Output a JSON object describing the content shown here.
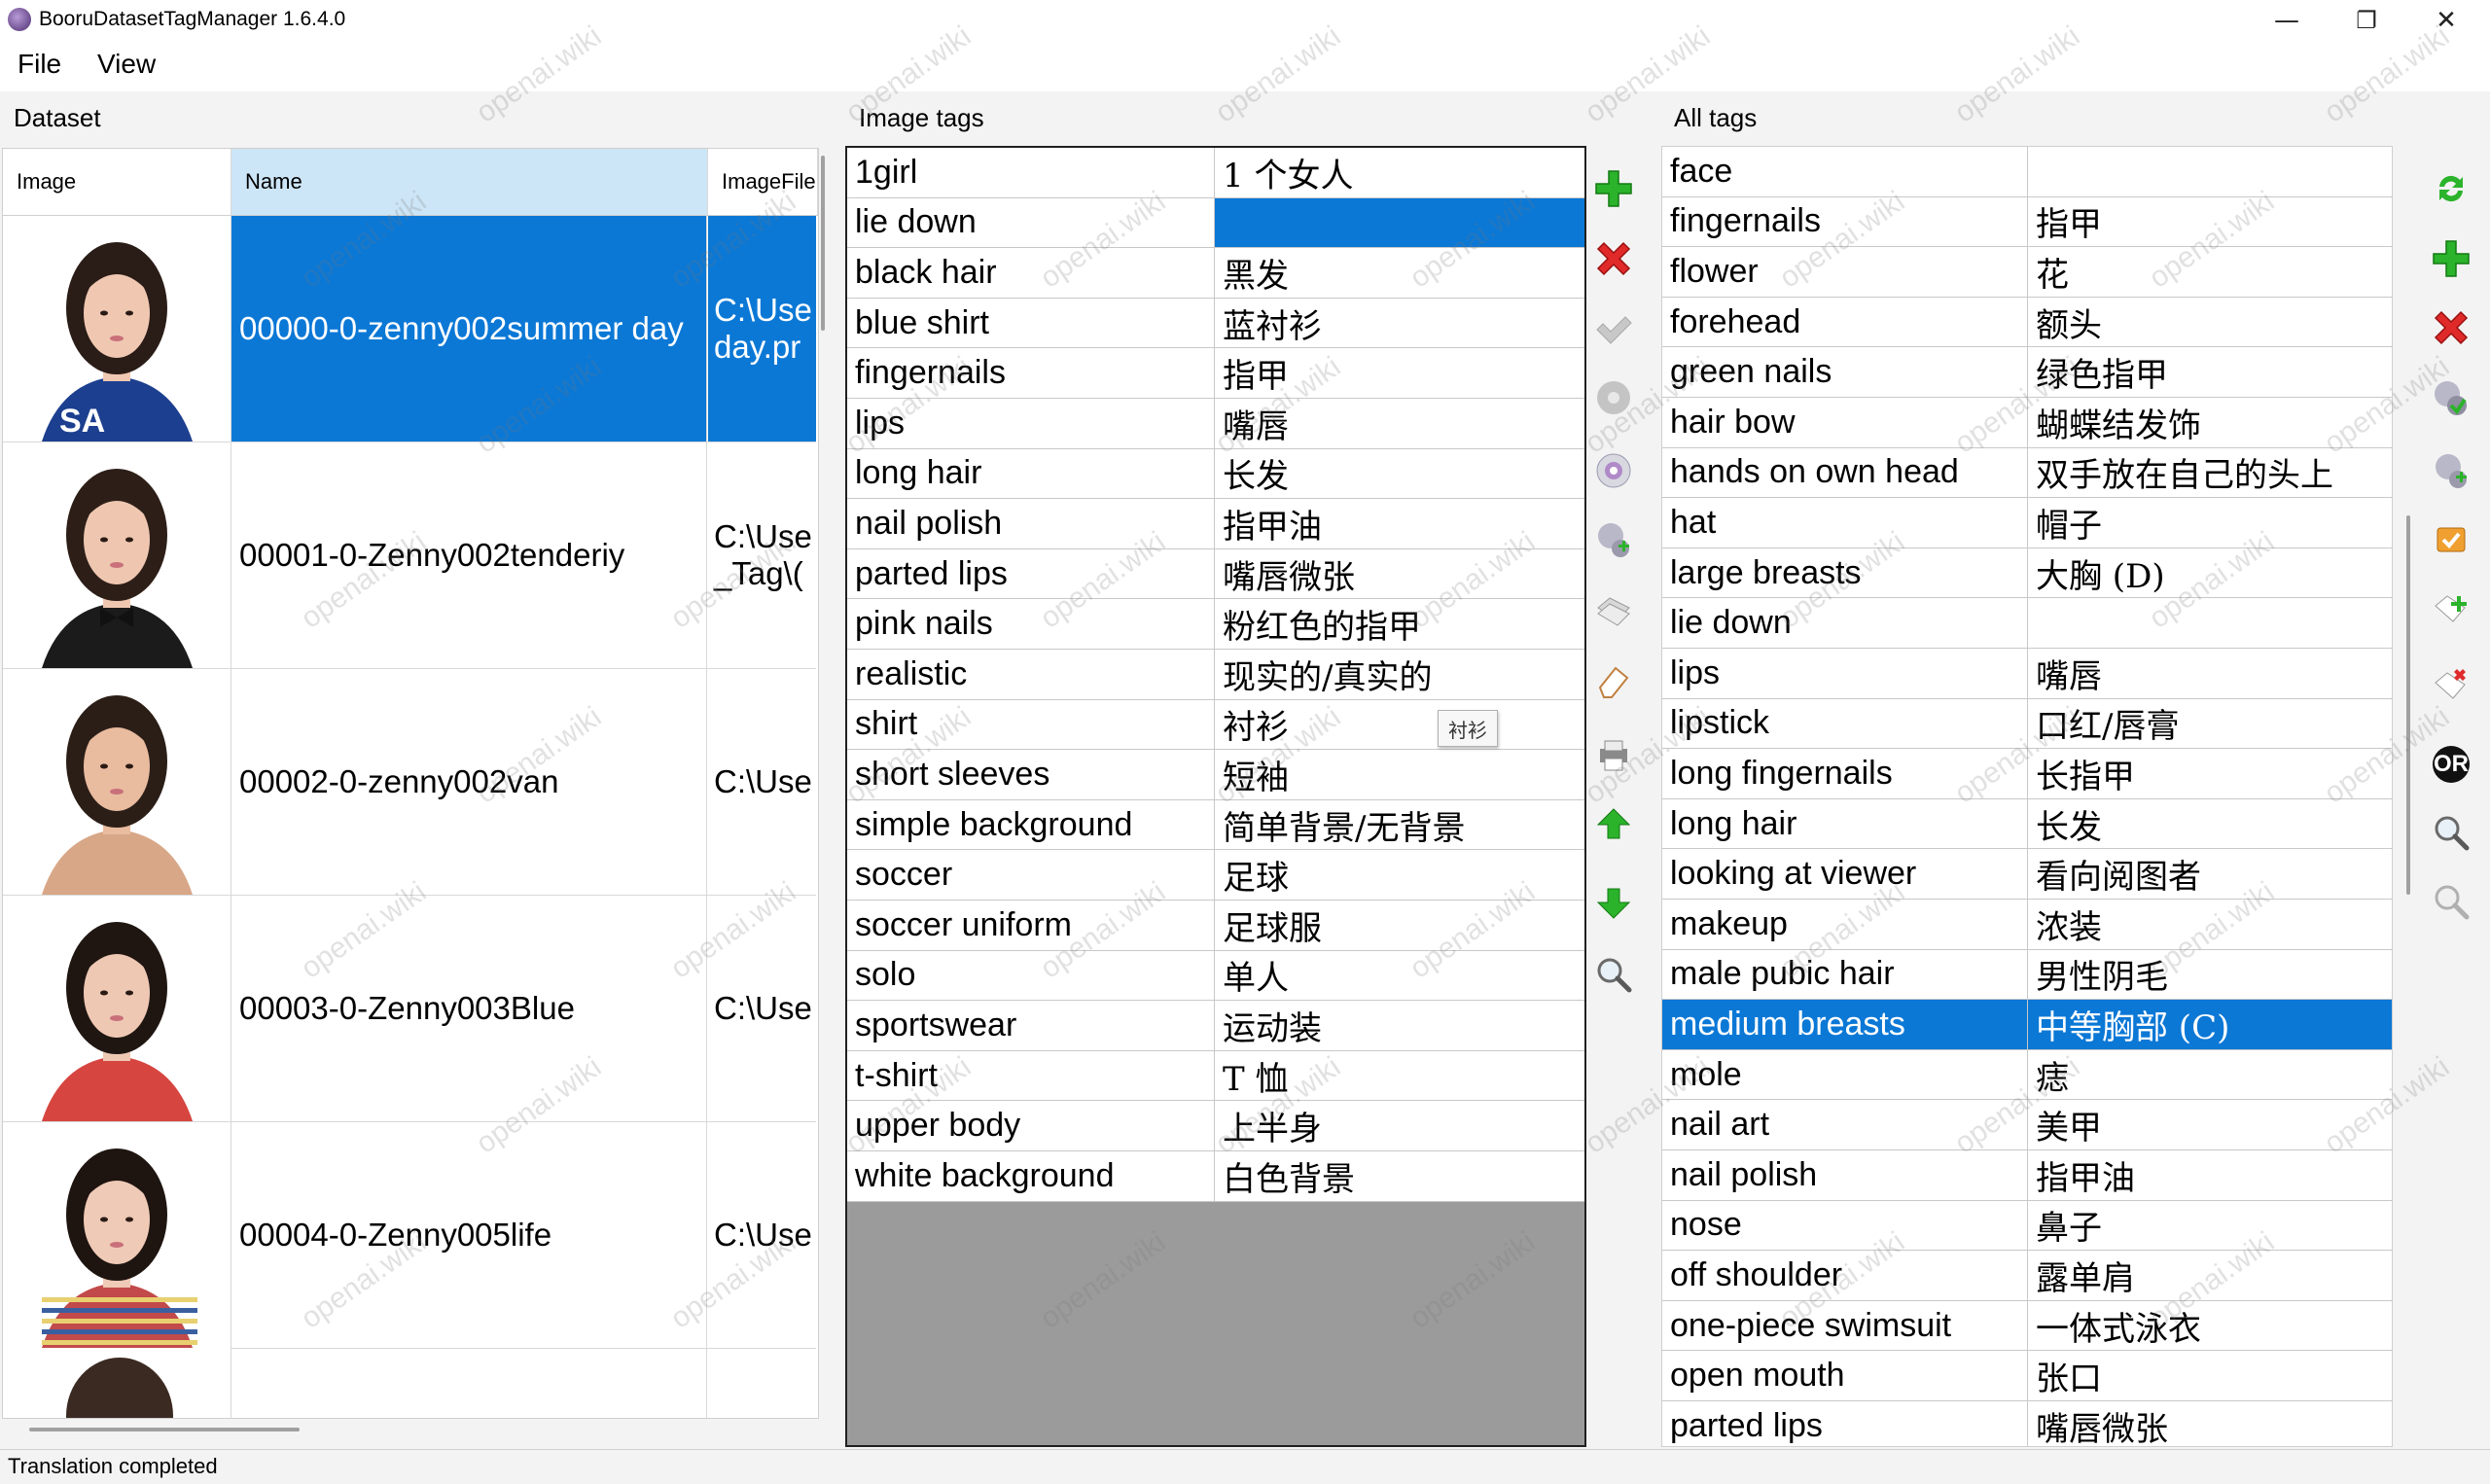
{
  "window": {
    "title": "BooruDatasetTagManager 1.6.4.0",
    "minimize": "—",
    "restore": "❐",
    "close": "✕"
  },
  "menu": [
    "File",
    "View"
  ],
  "labels": {
    "dataset": "Dataset",
    "image_tags": "Image tags",
    "all_tags": "All tags"
  },
  "dataset": {
    "columns": [
      "Image",
      "Name",
      "ImageFile"
    ],
    "rows": [
      {
        "name": "00000-0-zenny002summer day",
        "file_line1": "C:\\Use",
        "file_line2": "day.pr",
        "selected": true
      },
      {
        "name": "00001-0-Zenny002tenderiy",
        "file_line1": "C:\\Use",
        "file_line2": "_Tag\\(",
        "selected": false
      },
      {
        "name": "00002-0-zenny002van",
        "file_line1": "C:\\Use",
        "file_line2": "",
        "selected": false
      },
      {
        "name": "00003-0-Zenny003Blue",
        "file_line1": "C:\\Use",
        "file_line2": "",
        "selected": false
      },
      {
        "name": "00004-0-Zenny005life",
        "file_line1": "C:\\Use",
        "file_line2": "",
        "selected": false
      }
    ]
  },
  "image_tags": [
    {
      "tag": "1girl",
      "trans": "1 个女人"
    },
    {
      "tag": "lie down",
      "trans": "",
      "selected": "trans"
    },
    {
      "tag": "black hair",
      "trans": "黑发"
    },
    {
      "tag": "blue shirt",
      "trans": "蓝衬衫"
    },
    {
      "tag": "fingernails",
      "trans": "指甲"
    },
    {
      "tag": "lips",
      "trans": "嘴唇"
    },
    {
      "tag": "long hair",
      "trans": "长发"
    },
    {
      "tag": "nail polish",
      "trans": "指甲油"
    },
    {
      "tag": "parted lips",
      "trans": "嘴唇微张"
    },
    {
      "tag": "pink nails",
      "trans": "粉红色的指甲"
    },
    {
      "tag": "realistic",
      "trans": "现实的/真实的"
    },
    {
      "tag": "shirt",
      "trans": "衬衫"
    },
    {
      "tag": "short sleeves",
      "trans": "短袖"
    },
    {
      "tag": "simple background",
      "trans": "简单背景/无背景"
    },
    {
      "tag": "soccer",
      "trans": "足球"
    },
    {
      "tag": "soccer uniform",
      "trans": "足球服"
    },
    {
      "tag": "solo",
      "trans": "单人"
    },
    {
      "tag": "sportswear",
      "trans": "运动装"
    },
    {
      "tag": "t-shirt",
      "trans": "T 恤"
    },
    {
      "tag": "upper body",
      "trans": "上半身"
    },
    {
      "tag": "white background",
      "trans": "白色背景"
    }
  ],
  "tooltip": "衬衫",
  "all_tags": [
    {
      "tag": "face",
      "trans": ""
    },
    {
      "tag": "fingernails",
      "trans": "指甲"
    },
    {
      "tag": "flower",
      "trans": "花"
    },
    {
      "tag": "forehead",
      "trans": "额头"
    },
    {
      "tag": "green nails",
      "trans": "绿色指甲"
    },
    {
      "tag": "hair bow",
      "trans": "蝴蝶结发饰"
    },
    {
      "tag": "hands on own head",
      "trans": "双手放在自己的头上"
    },
    {
      "tag": "hat",
      "trans": "帽子"
    },
    {
      "tag": "large breasts",
      "trans": "大胸 (D)"
    },
    {
      "tag": "lie down",
      "trans": ""
    },
    {
      "tag": "lips",
      "trans": "嘴唇"
    },
    {
      "tag": "lipstick",
      "trans": "口红/唇膏"
    },
    {
      "tag": "long fingernails",
      "trans": "长指甲"
    },
    {
      "tag": "long hair",
      "trans": "长发"
    },
    {
      "tag": "looking at viewer",
      "trans": "看向阅图者"
    },
    {
      "tag": "makeup",
      "trans": "浓装"
    },
    {
      "tag": "male pubic hair",
      "trans": "男性阴毛"
    },
    {
      "tag": "medium breasts",
      "trans": "中等胸部 (C)",
      "selected": "both"
    },
    {
      "tag": "mole",
      "trans": "痣"
    },
    {
      "tag": "nail art",
      "trans": "美甲"
    },
    {
      "tag": "nail polish",
      "trans": "指甲油"
    },
    {
      "tag": "nose",
      "trans": "鼻子"
    },
    {
      "tag": "off shoulder",
      "trans": "露单肩"
    },
    {
      "tag": "one-piece swimsuit",
      "trans": "一体式泳衣"
    },
    {
      "tag": "open mouth",
      "trans": "张口"
    },
    {
      "tag": "parted lips",
      "trans": "嘴唇微张"
    }
  ],
  "middle_toolbar": [
    "add-tag-icon",
    "delete-tag-icon",
    "apply-check-icon",
    "disabled-disc-icon",
    "disc-icon",
    "add-to-all-icon",
    "copy-tags-icon",
    "clear-eraser-icon",
    "print-icon",
    "move-up-icon",
    "move-down-icon",
    "search-icon"
  ],
  "right_toolbar": [
    "refresh-icon",
    "add-tag-icon",
    "delete-tag-icon",
    "add-to-image-icon",
    "add-to-all-icon",
    "add-to-selected-icon",
    "add-filter-icon",
    "remove-filter-icon",
    "or-filter-icon",
    "search-icon",
    "search-disabled-icon"
  ],
  "or_label": "OR",
  "status": "Translation completed",
  "watermark": "openai.wiki",
  "colors": {
    "selection": "#0b78d6",
    "grid_fill": "#9b9b9b"
  }
}
